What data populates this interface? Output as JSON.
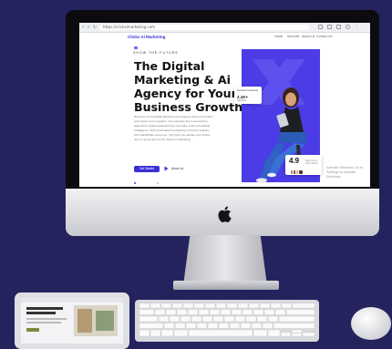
{
  "browser": {
    "url": "https://clickaimarketing.com"
  },
  "site": {
    "logo": "Clicks AI Marketing",
    "menu": [
      "Home",
      "Services",
      "About Us",
      "Contact Us"
    ],
    "eyebrow": "SHOW THE FUTURE",
    "headline": "The Digital Marketing & Ai Agency for Your Business Growth",
    "paragraph": "Welcome to the Digital Marketing & Ai agency where innovation and impact come together. Our expertise lies in developing data-driven digital strategies that use state-of-the-art artificial intelligence. With personalized marketing on-brand creativity and quantifiable outcomes, may help you elevate your brand. Join us as we get into the future of marketing.",
    "cta_label": "Get Started",
    "about_label": "About Us",
    "customer_card": {
      "title": "Success Customer",
      "number": "2.1K+",
      "subtitle": "Satisfied"
    },
    "rating_card": {
      "rating": "4.9",
      "subtitle": "Rating from 450+ clients"
    }
  },
  "overlay": {
    "activate_windows": "Activate Windows\nGo to Settings to activate Windows."
  },
  "colors": {
    "background": "#25235e",
    "brand": "#3b2fd9",
    "hero_panel": "#4b3ce6"
  },
  "icons": [
    "back-arrow-icon",
    "forward-arrow-icon",
    "reload-icon",
    "play-icon",
    "apple-logo-icon"
  ]
}
